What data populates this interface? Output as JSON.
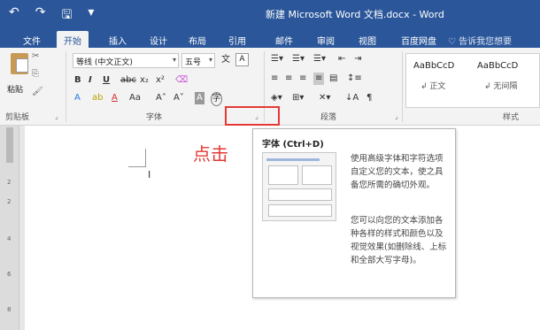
{
  "titlebar": {
    "undo_icon": "undo-icon",
    "redo_icon": "redo-icon",
    "save_icon": "save-icon",
    "qat_more": "▾",
    "title": "新建 Microsoft Word 文档.docx - Word"
  },
  "tabs": [
    {
      "label": "文件"
    },
    {
      "label": "开始"
    },
    {
      "label": "插入"
    },
    {
      "label": "设计"
    },
    {
      "label": "布局"
    },
    {
      "label": "引用"
    },
    {
      "label": "邮件"
    },
    {
      "label": "审阅"
    },
    {
      "label": "视图"
    },
    {
      "label": "百度网盘"
    }
  ],
  "tellme": "♡ 告诉我您想要",
  "clipboard": {
    "paste_label": "粘贴",
    "group_label": "剪贴板"
  },
  "font": {
    "font_name": "等线 (中文正文)",
    "font_size": "五号",
    "bold": "B",
    "italic": "I",
    "underline": "U",
    "strike": "abc",
    "sub": "x₂",
    "sup": "x²",
    "grow": "A˄",
    "shrink": "A˅",
    "aa": "Aa",
    "group_label": "字体"
  },
  "paragraph": {
    "group_label": "段落"
  },
  "styles": {
    "cards": [
      {
        "sample": "AaBbCcD",
        "name": "↲ 正文"
      },
      {
        "sample": "AaBbCcD",
        "name": "↲ 无间隔"
      }
    ],
    "group_label": "样式"
  },
  "annotation": {
    "click_text": "点击"
  },
  "tooltip": {
    "title": "字体 (Ctrl+D)",
    "desc1": "使用高级字体和字符选项自定义您的文本，使之具备您所需的确切外观。",
    "desc2": "您可以向您的文本添加各种各样的样式和颜色以及视觉效果(如删除线、上标和全部大写字母)。"
  },
  "ruler": {
    "marks": [
      "2",
      "2",
      "4",
      "6",
      "8"
    ]
  },
  "colors": {
    "title_bar": "#2b579a",
    "ribbon": "#f3f3f3",
    "highlight": "#e53935"
  }
}
